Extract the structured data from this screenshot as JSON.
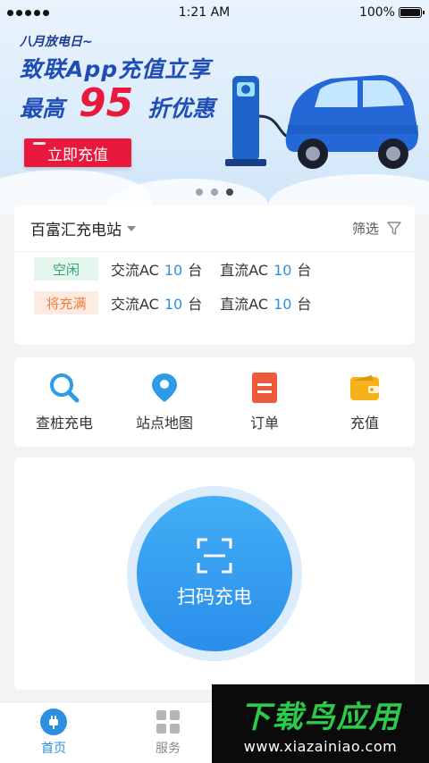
{
  "status_bar": {
    "time": "1:21 AM",
    "battery": "100%",
    "battery_level": 1.0
  },
  "banner": {
    "small_text": "八月放电日~",
    "line1": "致联App充值立享",
    "line2_prefix": "最高",
    "line2_number": "95",
    "line2_suffix": "折优惠",
    "button_label": "立即充值",
    "page_count": 3,
    "active_index": 2
  },
  "station": {
    "name": "百富汇充电站",
    "filter_label": "筛选",
    "rows": [
      {
        "status": "空闲",
        "ac_label": "交流AC",
        "ac_count": "10",
        "dc_label": "直流AC",
        "dc_count": "10",
        "unit": "台"
      },
      {
        "status": "将充满",
        "ac_label": "交流AC",
        "ac_count": "10",
        "dc_label": "直流AC",
        "dc_count": "10",
        "unit": "台"
      }
    ]
  },
  "menu": {
    "items": [
      {
        "label": "查桩充电",
        "icon": "search-icon"
      },
      {
        "label": "站点地图",
        "icon": "map-pin-icon"
      },
      {
        "label": "订单",
        "icon": "order-icon"
      },
      {
        "label": "充值",
        "icon": "wallet-icon"
      }
    ]
  },
  "scan": {
    "label": "扫码充电",
    "icon": "scan-icon"
  },
  "tabbar": {
    "items": [
      {
        "label": "首页",
        "icon": "plug-icon",
        "active": true
      },
      {
        "label": "服务",
        "icon": "grid-icon",
        "active": false
      }
    ]
  },
  "watermark": {
    "title": "下载鸟应用",
    "url": "www.xiazainiao.com"
  },
  "colors": {
    "accent": "#2e8fe0",
    "banner_red": "#e8193c",
    "idle_green": "#2fa36a",
    "full_orange": "#f07c3e"
  }
}
